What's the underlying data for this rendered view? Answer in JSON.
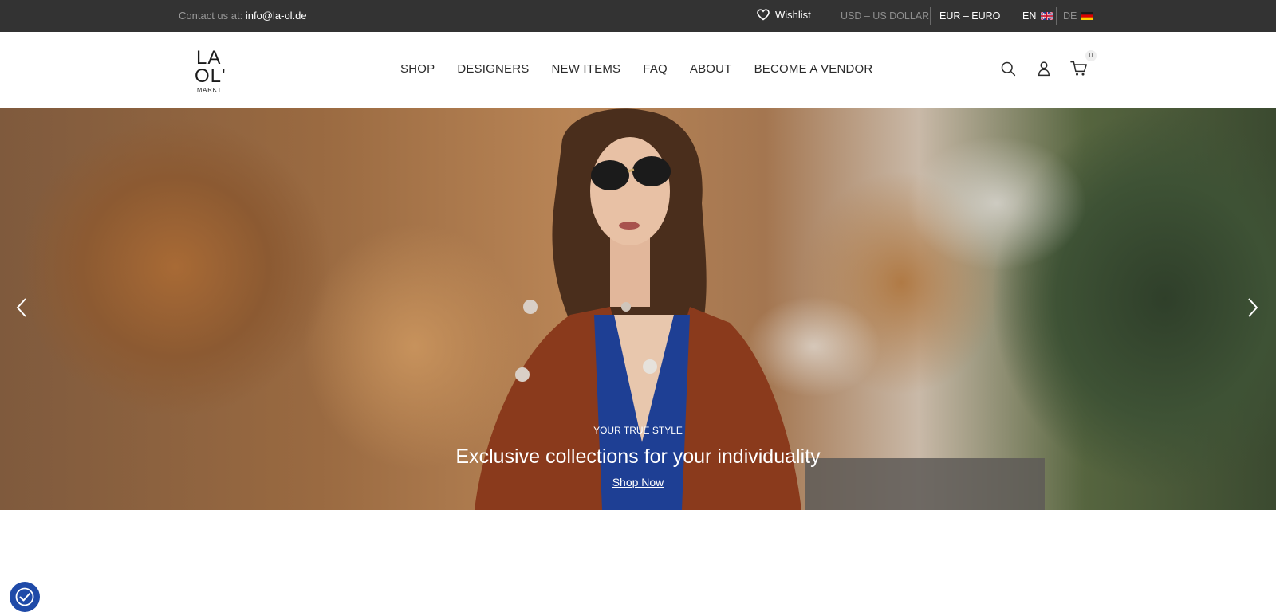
{
  "topbar": {
    "contact_prefix": "Contact us at:",
    "contact_email": "info@la-ol.de",
    "wishlist_label": "Wishlist",
    "currency_usd": "USD – US DOLLAR",
    "currency_eur": "EUR – EURO",
    "lang_en": "EN",
    "lang_de": "DE",
    "icons": [
      "heart-icon",
      "uk-flag-icon",
      "germany-flag-icon"
    ]
  },
  "header": {
    "logo_text": [
      "LA",
      "OL'",
      "MARKT"
    ],
    "nav": [
      "SHOP",
      "DESIGNERS",
      "NEW ITEMS",
      "FAQ",
      "ABOUT",
      "BECOME A VENDOR"
    ],
    "cart_count": "0",
    "icons": [
      "search-icon",
      "user-icon",
      "cart-icon"
    ]
  },
  "hero": {
    "eyebrow": "YOUR TRUE STYLE",
    "title": "Exclusive collections for your individuality",
    "cta": "Shop Now",
    "icons": [
      "chevron-left-icon",
      "chevron-right-icon"
    ]
  },
  "accessibility": {
    "icon": "accessibility-icon"
  },
  "colors": {
    "topbar": "#333333",
    "accessibility_button": "#1f4aa8",
    "text_dark": "#2b2b2b"
  }
}
